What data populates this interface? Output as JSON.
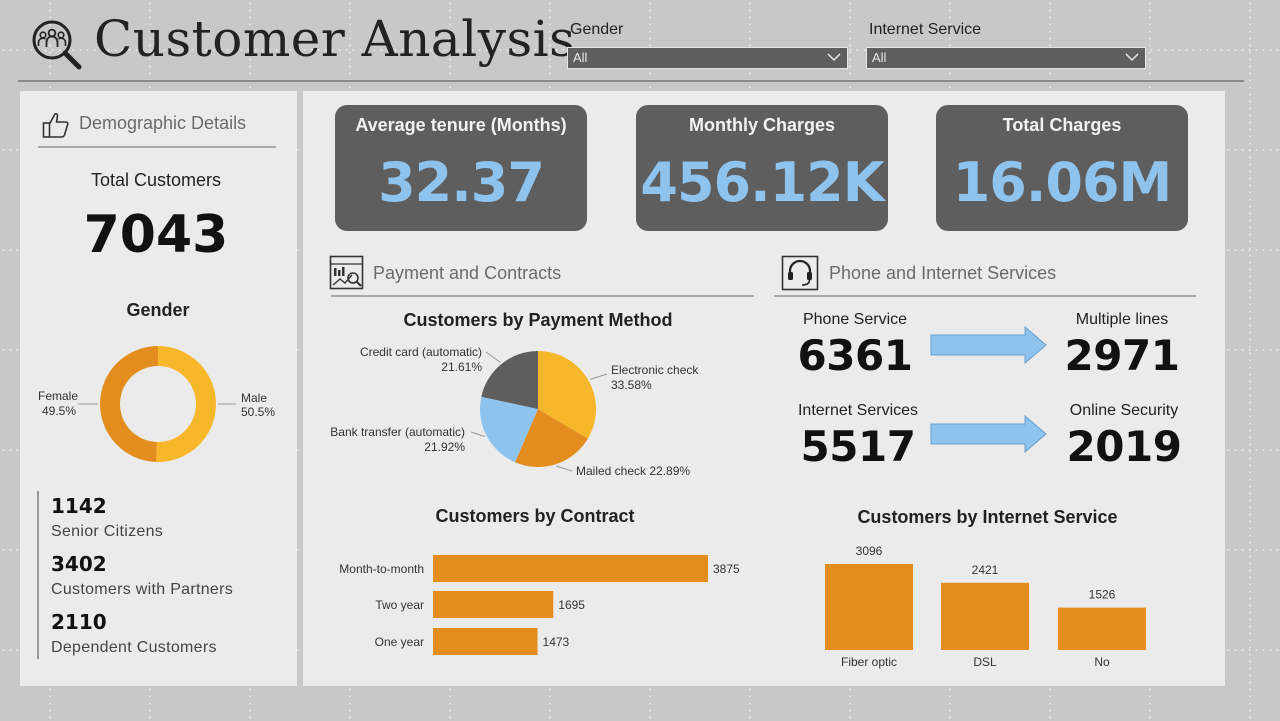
{
  "header": {
    "title": "Customer Analysis",
    "icon": "customers-search-icon"
  },
  "filters": [
    {
      "label": "Gender",
      "value": "All"
    },
    {
      "label": "Internet Service",
      "value": "All"
    }
  ],
  "demographics": {
    "section_title": "Demographic Details",
    "icon": "thumbs-up-icon",
    "total_customers_label": "Total Customers",
    "total_customers_value": "7043",
    "gender_title": "Gender",
    "stats": [
      {
        "value": "1142",
        "label": "Senior Citizens"
      },
      {
        "value": "3402",
        "label": "Customers with Partners"
      },
      {
        "value": "2110",
        "label": "Dependent Customers"
      }
    ]
  },
  "kpis": [
    {
      "label": "Average tenure (Months)",
      "value": "32.37"
    },
    {
      "label": "Monthly Charges",
      "value": "456.12K"
    },
    {
      "label": "Total Charges",
      "value": "16.06M"
    }
  ],
  "payment_section": {
    "title": "Payment and Contracts",
    "icon": "report-chart-icon"
  },
  "services_section": {
    "title": "Phone and Internet Services",
    "icon": "headset-icon"
  },
  "services": [
    {
      "label": "Phone Service",
      "value": "6361"
    },
    {
      "label": "Multiple lines",
      "value": "2971"
    },
    {
      "label": "Internet Services",
      "value": "5517"
    },
    {
      "label": "Online Security",
      "value": "2019"
    }
  ],
  "colors": {
    "orange": "#e38d1f",
    "dark_orange": "#e08b1e",
    "yellow": "#f7b72a",
    "blue": "#8ec3ee",
    "gray": "#5e5e5e",
    "arrow": "#8ec3ee"
  },
  "chart_data": [
    {
      "type": "pie",
      "title": "Gender",
      "donut": true,
      "slices": [
        {
          "name": "Female",
          "value": 49.5,
          "label": "Female",
          "pct": "49.5%",
          "color": "#e38d1f"
        },
        {
          "name": "Male",
          "value": 50.5,
          "label": "Male",
          "pct": "50.5%",
          "color": "#f7b72a"
        }
      ]
    },
    {
      "type": "pie",
      "title": "Customers by Payment Method",
      "slices": [
        {
          "name": "Electronic check",
          "value": 33.58,
          "label": "Electronic check",
          "pct": "33.58%",
          "color": "#f7b72a"
        },
        {
          "name": "Mailed check",
          "value": 22.89,
          "label": "Mailed check 22.89%",
          "pct": "",
          "color": "#e38d1f"
        },
        {
          "name": "Bank transfer (automatic)",
          "value": 21.92,
          "label": "Bank transfer (automatic)",
          "pct": "21.92%",
          "color": "#8ec3ee"
        },
        {
          "name": "Credit card (automatic)",
          "value": 21.61,
          "label": "Credit card (automatic)",
          "pct": "21.61%",
          "color": "#5e5e5e"
        }
      ]
    },
    {
      "type": "bar",
      "orientation": "horizontal",
      "title": "Customers by Contract",
      "categories": [
        "Month-to-month",
        "Two year",
        "One year"
      ],
      "values": [
        3875,
        1695,
        1473
      ],
      "color": "#e38d1f"
    },
    {
      "type": "bar",
      "orientation": "vertical",
      "title": "Customers by Internet Service",
      "categories": [
        "Fiber optic",
        "DSL",
        "No"
      ],
      "values": [
        3096,
        2421,
        1526
      ],
      "color": "#e38d1f"
    }
  ]
}
